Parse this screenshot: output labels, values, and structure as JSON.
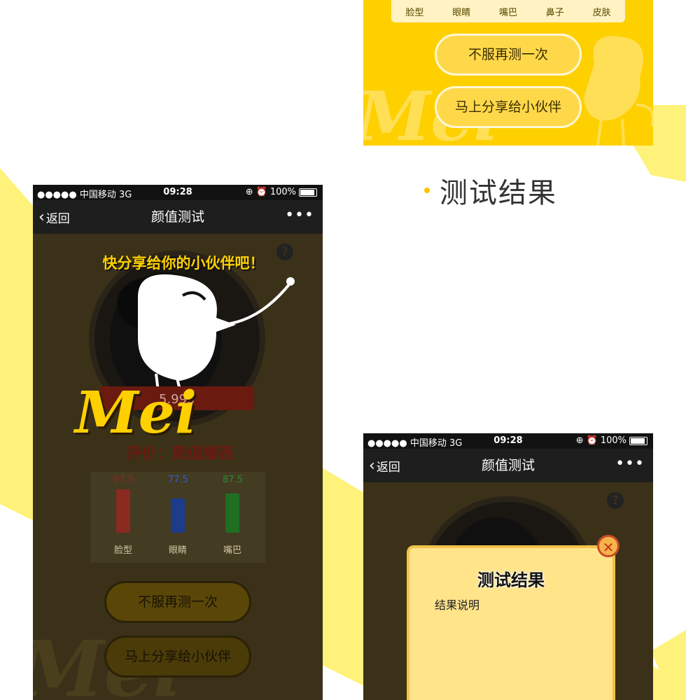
{
  "top_card": {
    "labels": [
      "脸型",
      "眼睛",
      "嘴巴",
      "鼻子",
      "皮肤"
    ],
    "retry_button": "不服再测一次",
    "share_button": "马上分享给小伙伴"
  },
  "section_title": "测试结果",
  "status": {
    "carrier": "●●●●● 中国移动  3G",
    "time": "09:28",
    "battery": "100%"
  },
  "navbar": {
    "back": "返回",
    "title": "颜值测试",
    "more": "•••"
  },
  "left_phone": {
    "share_hint": "快分享给你的小伙伴吧！",
    "logo": "Mei",
    "score_ribbon": "5.995",
    "tagline": "评价：颜值爆表",
    "meters": [
      {
        "value": "97.5",
        "label": "脸型",
        "color": "#8a2a20"
      },
      {
        "value": "77.5",
        "label": "眼睛",
        "color": "#1d3d8a"
      },
      {
        "value": "87.5",
        "label": "嘴巴",
        "color": "#1f6e22"
      }
    ],
    "meter_levels": [
      0.97,
      0.77,
      0.87
    ],
    "retry_button": "不服再测一次",
    "share_button": "马上分享给小伙伴",
    "watermark": "Mei"
  },
  "right_phone": {
    "modal_title": "测试结果",
    "modal_desc": "结果说明",
    "close_icon": "close-icon"
  },
  "colors": {
    "accent": "#ffd000",
    "pale": "#fff27a",
    "dark_bg": "#3a3118"
  }
}
